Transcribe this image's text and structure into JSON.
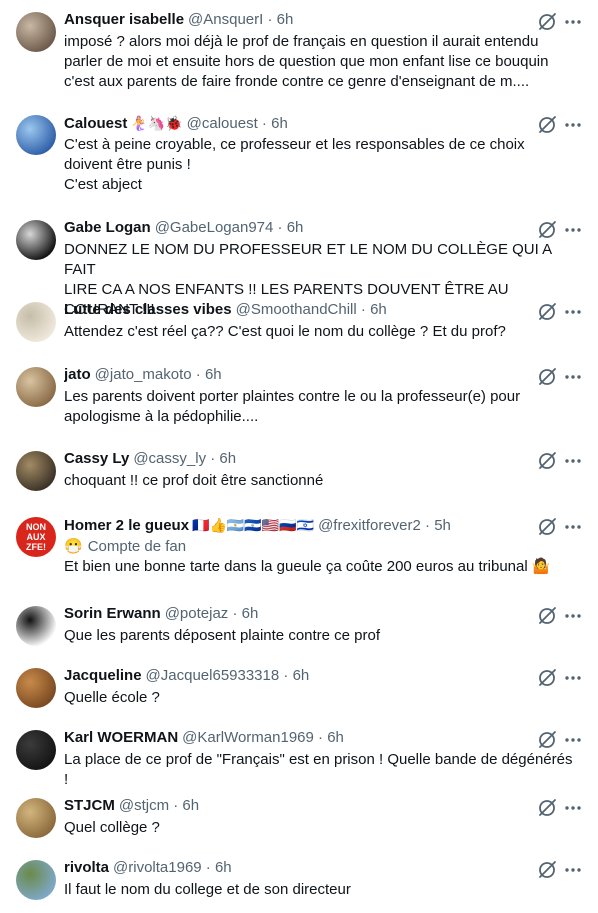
{
  "replies": [
    {
      "name": "Ansquer isabelle",
      "handle": "@AnsquerI",
      "time": "6h",
      "lines": [
        "imposé ? alors moi déjà le prof de français en question il aurait entendu",
        "parler de moi et ensuite hors de question que mon enfant lise ce bouquin",
        "c'est aux parents de faire fronde contre ce genre d'enseignant de m...."
      ],
      "avatar_colors": [
        "#6d5a4a",
        "#c9b8a6"
      ]
    },
    {
      "name": "Calouest",
      "emoji": "🧜‍♀️🦄🐞",
      "handle": "@calouest",
      "time": "6h",
      "lines": [
        "C'est à peine croyable, ce professeur et les responsables de ce choix",
        "doivent être punis !",
        "C'est abject"
      ],
      "avatar_colors": [
        "#2f5fa8",
        "#9cc7ef"
      ]
    },
    {
      "name": "Gabe Logan",
      "handle": "@GabeLogan974",
      "time": "6h",
      "lines": [
        "DONNEZ LE NOM DU PROFESSEUR ET LE NOM DU COLLÈGE QUI A FAIT",
        "LIRE CA A NOS ENFANTS !! LES PARENTS DOUVENT ÊTRE AU COURANT !!!"
      ],
      "avatar_colors": [
        "#111111",
        "#d7d7d7"
      ]
    },
    {
      "name": "Lutte des classes vibes",
      "handle": "@SmoothandChill",
      "time": "6h",
      "lines": [
        "Attendez c'est réel ça?? C'est quoi le nom du collège ? Et du prof?"
      ],
      "avatar_colors": [
        "#efe9dc",
        "#c6bda9"
      ]
    },
    {
      "name": "jato",
      "handle": "@jato_makoto",
      "time": "6h",
      "lines": [
        "Les parents doivent porter plaintes contre le ou la professeur(e) pour",
        "apologisme à la pédophilie...."
      ],
      "avatar_colors": [
        "#8a6b47",
        "#d9c3a0"
      ]
    },
    {
      "name": "Cassy Ly",
      "handle": "@cassy_ly",
      "time": "6h",
      "lines": [
        "choquant !! ce prof doit être sanctionné"
      ],
      "avatar_colors": [
        "#3a3226",
        "#a38b64"
      ]
    },
    {
      "name": "Homer 2 le gueux",
      "emoji": "🇫🇷👍🇦🇷🇸🇻🇺🇸🇷🇺🇮🇱",
      "handle": "@frexitforever2",
      "time": "5h",
      "badge": "Compte de fan",
      "lines": [
        "Et bien une bonne tarte dans la gueule ça coûte 200 euros au tribunal 🤷"
      ],
      "avatar_lines": [
        "NON",
        "AUX",
        "ZFE!"
      ],
      "avatar_colors": [
        "#d9261c",
        "#ffffff"
      ]
    },
    {
      "name": "Sorin Erwann",
      "handle": "@potejaz",
      "time": "6h",
      "lines": [
        "Que les parents déposent plainte contre ce prof"
      ],
      "avatar_colors": [
        "#ffffff",
        "#111111"
      ]
    },
    {
      "name": "Jacqueline",
      "handle": "@Jacquel65933318",
      "time": "6h",
      "lines": [
        "Quelle école ?"
      ],
      "avatar_colors": [
        "#7a4a22",
        "#c98a4a"
      ]
    },
    {
      "name": "Karl WOERMAN",
      "handle": "@KarlWorman1969",
      "time": "6h",
      "lines": [
        "La place de ce prof de \"Français\" est en prison !  Quelle bande de dégénérés",
        "!"
      ],
      "avatar_colors": [
        "#141414",
        "#3b3b3b"
      ]
    },
    {
      "name": "STJCM",
      "handle": "@stjcm",
      "time": "6h",
      "lines": [
        "Quel collège ?"
      ],
      "avatar_colors": [
        "#8c6a3c",
        "#d2b57d"
      ]
    },
    {
      "name": "rivolta",
      "handle": "@rivolta1969",
      "time": "6h",
      "lines": [
        "Il faut le nom du college et de son directeur"
      ],
      "avatar_colors": [
        "#7fa8c9",
        "#6b8a4a"
      ]
    }
  ]
}
